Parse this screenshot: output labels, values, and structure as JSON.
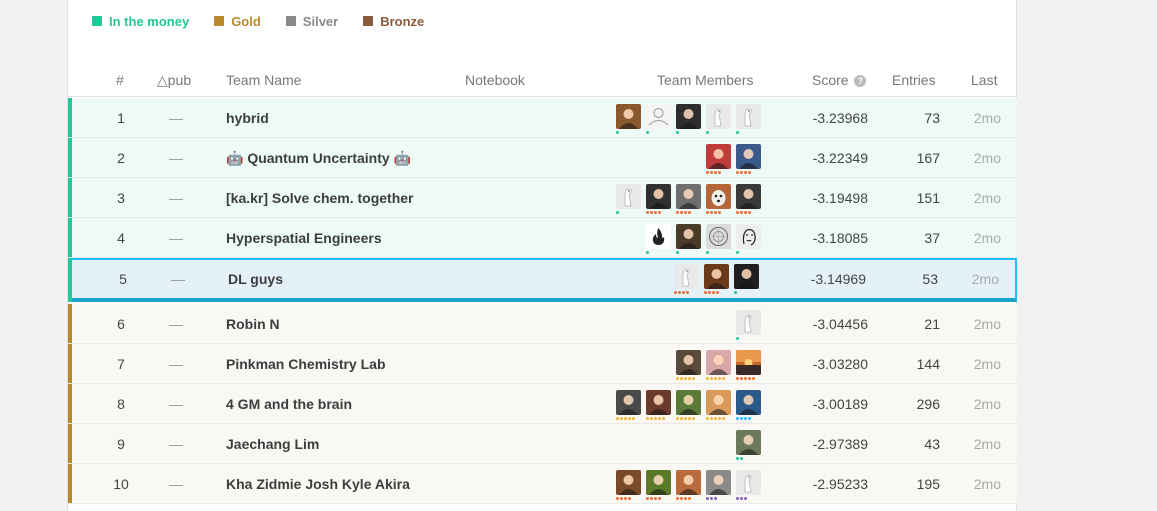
{
  "legend": [
    {
      "label": "In the money",
      "color": "#20c997"
    },
    {
      "label": "Gold",
      "color": "#b88a2b"
    },
    {
      "label": "Silver",
      "color": "#8a8a8a"
    },
    {
      "label": "Bronze",
      "color": "#8b5a3c"
    }
  ],
  "header": {
    "rank": "#",
    "delta": "△pub",
    "team": "Team Name",
    "notebook": "Notebook",
    "members": "Team Members",
    "score": "Score",
    "entries": "Entries",
    "last": "Last"
  },
  "rows": [
    {
      "rank": "1",
      "delta": "—",
      "team": "hybrid",
      "score": "-3.23968",
      "entries": "73",
      "last": "2mo",
      "band": "#20c997",
      "bg": "#eefaf6",
      "selected": false,
      "members": [
        {
          "icon": "photo-avatar-icon",
          "color": "#8a5a2e",
          "tier": 1,
          "tierColor": "#20c997"
        },
        {
          "icon": "person-outline-icon",
          "color": "#f4f4f4",
          "tier": 1,
          "tierColor": "#20c997"
        },
        {
          "icon": "photo-avatar-icon",
          "color": "#2d2d2d",
          "tier": 1,
          "tierColor": "#20c997"
        },
        {
          "icon": "kaggle-goose-icon",
          "color": "#e9e9e9",
          "tier": 1,
          "tierColor": "#20c997"
        },
        {
          "icon": "kaggle-goose-icon",
          "color": "#e9e9e9",
          "tier": 1,
          "tierColor": "#20c997"
        }
      ]
    },
    {
      "rank": "2",
      "delta": "—",
      "team": "🤖 Quantum Uncertainty 🤖",
      "score": "-3.22349",
      "entries": "167",
      "last": "2mo",
      "band": "#20c997",
      "bg": "#eefaf6",
      "selected": false,
      "members": [
        {
          "icon": "photo-avatar-icon",
          "color": "#c23b3b",
          "tier": 4,
          "tierColor": "#f26b3a"
        },
        {
          "icon": "photo-avatar-icon",
          "color": "#3b5a8a",
          "tier": 4,
          "tierColor": "#f26b3a"
        }
      ]
    },
    {
      "rank": "3",
      "delta": "—",
      "team": "[ka.kr] Solve chem. together",
      "score": "-3.19498",
      "entries": "151",
      "last": "2mo",
      "band": "#20c997",
      "bg": "#eefaf6",
      "selected": false,
      "members": [
        {
          "icon": "kaggle-goose-icon",
          "color": "#e9e9e9",
          "tier": 1,
          "tierColor": "#20c997"
        },
        {
          "icon": "photo-avatar-icon",
          "color": "#303030",
          "tier": 4,
          "tierColor": "#f26b3a"
        },
        {
          "icon": "photo-avatar-icon",
          "color": "#6e6e6e",
          "tier": 4,
          "tierColor": "#f26b3a"
        },
        {
          "icon": "dog-photo-icon",
          "color": "#b5653a",
          "tier": 4,
          "tierColor": "#f26b3a"
        },
        {
          "icon": "photo-avatar-icon",
          "color": "#3a3a3a",
          "tier": 4,
          "tierColor": "#f26b3a"
        }
      ]
    },
    {
      "rank": "4",
      "delta": "—",
      "team": "Hyperspatial Engineers",
      "score": "-3.18085",
      "entries": "37",
      "last": "2mo",
      "band": "#20c997",
      "bg": "#eefaf6",
      "selected": false,
      "members": [
        {
          "icon": "fire-logo-icon",
          "color": "#ffffff",
          "tier": 1,
          "tierColor": "#20c997"
        },
        {
          "icon": "photo-avatar-icon",
          "color": "#4a3a2a",
          "tier": 1,
          "tierColor": "#20c997"
        },
        {
          "icon": "sketch-avatar-icon",
          "color": "#dcdcdc",
          "tier": 1,
          "tierColor": "#20c997"
        },
        {
          "icon": "sketch-face-icon",
          "color": "#eeeeee",
          "tier": 1,
          "tierColor": "#20c997"
        }
      ]
    },
    {
      "rank": "5",
      "delta": "—",
      "team": "DL guys",
      "score": "-3.14969",
      "entries": "53",
      "last": "2mo",
      "band": "#20c997",
      "bg": "#e4f1f8",
      "selected": true,
      "members": [
        {
          "icon": "kaggle-goose-icon",
          "color": "#e9e9e9",
          "tier": 4,
          "tierColor": "#f26b3a"
        },
        {
          "icon": "photo-avatar-icon",
          "color": "#6b3a1a",
          "tier": 4,
          "tierColor": "#f26b3a"
        },
        {
          "icon": "photo-avatar-icon",
          "color": "#1e1e1e",
          "tier": 1,
          "tierColor": "#20c997"
        }
      ]
    },
    {
      "rank": "6",
      "delta": "—",
      "team": "Robin N",
      "score": "-3.04456",
      "entries": "21",
      "last": "2mo",
      "band": "#b88a2b",
      "bg": "#faf8f4",
      "selected": false,
      "members": [
        {
          "icon": "kaggle-goose-icon",
          "color": "#e9e9e9",
          "tier": 1,
          "tierColor": "#20c997"
        }
      ]
    },
    {
      "rank": "7",
      "delta": "—",
      "team": "Pinkman Chemistry Lab",
      "score": "-3.03280",
      "entries": "144",
      "last": "2mo",
      "band": "#b88a2b",
      "bg": "#faf8f4",
      "selected": false,
      "members": [
        {
          "icon": "photo-avatar-icon",
          "color": "#5a4a3a",
          "tier": 5,
          "tierColor": "#f5b83d"
        },
        {
          "icon": "photo-avatar-icon",
          "color": "#d8a8a8",
          "tier": 5,
          "tierColor": "#f5b83d"
        },
        {
          "icon": "sunset-photo-icon",
          "color": "#c8662a",
          "tier": 5,
          "tierColor": "#f26b3a"
        }
      ]
    },
    {
      "rank": "8",
      "delta": "—",
      "team": "4 GM and the brain",
      "score": "-3.00189",
      "entries": "296",
      "last": "2mo",
      "band": "#b88a2b",
      "bg": "#faf8f4",
      "selected": false,
      "members": [
        {
          "icon": "photo-avatar-icon",
          "color": "#4a4a4a",
          "tier": 5,
          "tierColor": "#f5b83d"
        },
        {
          "icon": "photo-avatar-icon",
          "color": "#6a3a2a",
          "tier": 5,
          "tierColor": "#f5b83d"
        },
        {
          "icon": "photo-avatar-icon",
          "color": "#5a7a3a",
          "tier": 5,
          "tierColor": "#f5b83d"
        },
        {
          "icon": "photo-avatar-icon",
          "color": "#d89a5a",
          "tier": 5,
          "tierColor": "#f5b83d"
        },
        {
          "icon": "photo-avatar-icon",
          "color": "#2a5a8a",
          "tier": 4,
          "tierColor": "#20beff"
        }
      ]
    },
    {
      "rank": "9",
      "delta": "—",
      "team": "Jaechang Lim",
      "score": "-2.97389",
      "entries": "43",
      "last": "2mo",
      "band": "#b88a2b",
      "bg": "#faf8f4",
      "selected": false,
      "members": [
        {
          "icon": "photo-avatar-icon",
          "color": "#6a7a5a",
          "tier": 2,
          "tierColor": "#20c997"
        }
      ]
    },
    {
      "rank": "10",
      "delta": "—",
      "team": "Kha Zidmie Josh Kyle Akira",
      "score": "-2.95233",
      "entries": "195",
      "last": "2mo",
      "band": "#b88a2b",
      "bg": "#faf8f4",
      "selected": false,
      "members": [
        {
          "icon": "photo-avatar-icon",
          "color": "#7a4a2a",
          "tier": 4,
          "tierColor": "#f26b3a"
        },
        {
          "icon": "photo-avatar-icon",
          "color": "#5a7a2a",
          "tier": 4,
          "tierColor": "#f26b3a"
        },
        {
          "icon": "photo-avatar-icon",
          "color": "#b86a3a",
          "tier": 4,
          "tierColor": "#f26b3a"
        },
        {
          "icon": "photo-avatar-icon",
          "color": "#8a8a8a",
          "tier": 3,
          "tierColor": "#8b5cb8"
        },
        {
          "icon": "kaggle-goose-icon",
          "color": "#e9e9e9",
          "tier": 3,
          "tierColor": "#8b5cb8"
        }
      ]
    }
  ]
}
